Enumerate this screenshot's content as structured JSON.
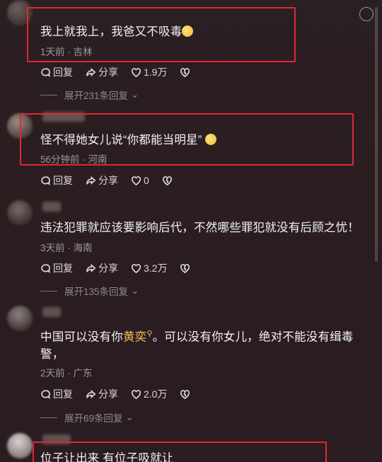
{
  "comments": [
    {
      "text": "我上就我上，我爸又不吸毒",
      "time": "1天前",
      "location": "吉林",
      "reply_label": "回复",
      "share_label": "分享",
      "likes": "1.9万",
      "expand": "展开231条回复"
    },
    {
      "text": "怪不得她女儿说“你都能当明星”",
      "time": "56分钟前",
      "location": "河南",
      "reply_label": "回复",
      "share_label": "分享",
      "likes": "0",
      "expand": ""
    },
    {
      "text": "违法犯罪就应该要影响后代，不然哪些罪犯就没有后顾之忧！",
      "time": "3天前",
      "location": "海南",
      "reply_label": "回复",
      "share_label": "分享",
      "likes": "3.2万",
      "expand": "展开135条回复"
    },
    {
      "text_prefix": "中国可以没有你",
      "keyword": "黄奕",
      "text_suffix": "。可以没有你女儿，绝对不能没有缉毒警，",
      "time": "2天前",
      "location": "广东",
      "reply_label": "回复",
      "share_label": "分享",
      "likes": "2.0万",
      "expand": "展开69条回复"
    },
    {
      "text": "位子让出来 有位子吸就让"
    }
  ],
  "separator": " · ",
  "colors": {
    "highlight": "#e0282e",
    "keyword": "#f2c14e",
    "background": "#2a1d21"
  }
}
